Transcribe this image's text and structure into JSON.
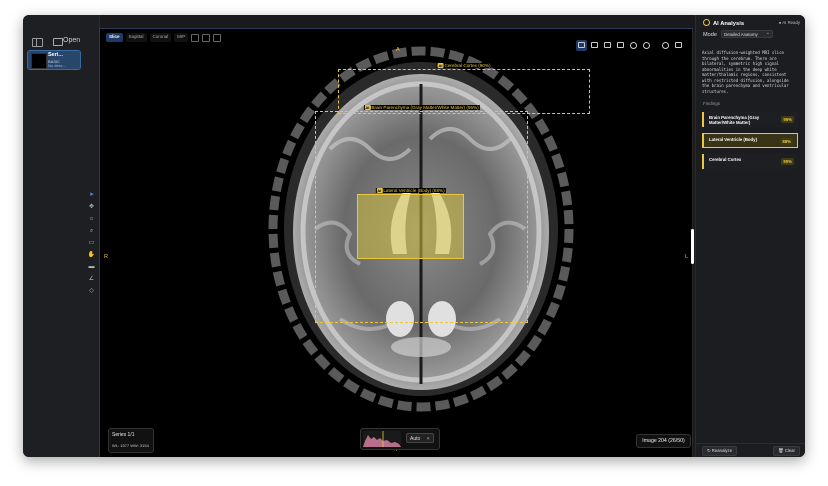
{
  "sidebar": {
    "open_label": "Open",
    "series": [
      {
        "name": "Seri...",
        "line1": "BASIC",
        "line2": "No desc..."
      }
    ]
  },
  "viewer": {
    "tabs": [
      "Slice",
      "Sagittal",
      "Coronal",
      "MIP"
    ],
    "active_tab": "Slice",
    "orientation": {
      "top": "A",
      "bottom": "P",
      "left": "R",
      "right": "L"
    },
    "annotations": [
      {
        "tag": "AI",
        "label": "Cerebral Cortex (90%)"
      },
      {
        "tag": "AI",
        "label": "Brain Parenchyma (Gray Matter/White Matter) (95%)"
      },
      {
        "tag": "AI",
        "label": "Lateral Ventricle (Body) (88%)"
      }
    ],
    "series_info": "Series 1/1",
    "window_level": "WL: 1577 WW: 3154",
    "histogram_mode": "Auto",
    "image_counter": "Image 204 (26/50)",
    "toolbar_icons": [
      "rectangle-icon",
      "zoom-in-icon",
      "annotate-icon",
      "measure-icon",
      "crosshair-icon",
      "settings-icon",
      "ai-eye-icon",
      "eraser-icon"
    ],
    "side_tools": [
      "pointer-icon",
      "pan-icon",
      "brightness-icon",
      "zoom-icon",
      "rectangle-icon",
      "hand-icon",
      "ruler-icon",
      "angle-icon",
      "eraser-icon"
    ]
  },
  "ai_panel": {
    "title": "AI Analysis",
    "status": "AI Ready",
    "mode_label": "Mode",
    "mode_value": "Detailed Anatomy",
    "description": "Axial diffusion-weighted MRI slice through the cerebrum. There are bilateral, symmetric high signal abnormalities in the deep white matter/thalamic regions, consistent with restricted diffusion, alongside the brain parenchyma and ventricular structures.",
    "findings_label": "Findings",
    "findings": [
      {
        "title": "Brain Parenchyma (Gray Matter/White Matter)",
        "confidence": "95%"
      },
      {
        "title": "Lateral Ventricle (Body)",
        "confidence": "88%"
      },
      {
        "title": "Cerebral Cortex",
        "confidence": "90%"
      }
    ],
    "reanalyze_label": "Reanalyze",
    "clear_label": "Clear"
  },
  "colors": {
    "accent": "#e9c840",
    "active_blue": "#1f3a66"
  }
}
